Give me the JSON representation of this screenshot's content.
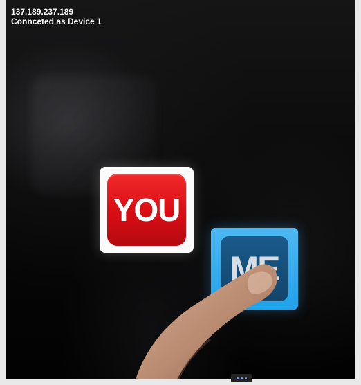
{
  "status": {
    "ip_address": "137.189.237.189",
    "connection": "Connceted as Device 1"
  },
  "tiles": {
    "you_label": "YOU",
    "me_label": "ME"
  },
  "pager": {
    "dots": 3
  },
  "colors": {
    "you_red": "#d80d14",
    "me_blue": "#21a2ea",
    "me_inner": "#12456c"
  }
}
